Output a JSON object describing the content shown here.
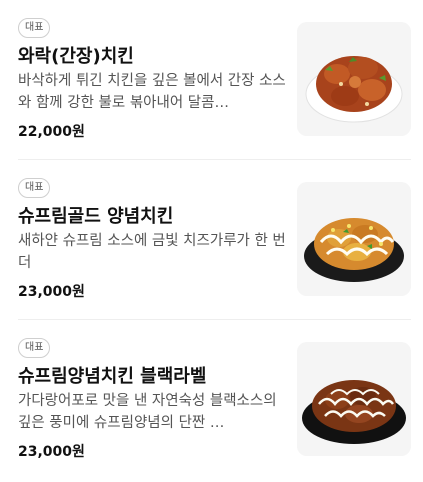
{
  "menu": {
    "items": [
      {
        "badge": "대표",
        "name": "와락(간장)치킨",
        "description": "바삭하게 튀긴 치킨을 깊은 볼에서 간장 소스와 함께 강한 불로 볶아내어 달콤…",
        "price": "22,000원",
        "image": "soy-sauce-chicken-photo"
      },
      {
        "badge": "대표",
        "name": "슈프림골드 양념치킨",
        "description": "새하얀 슈프림 소스에 금빛 치즈가루가 한 번 더",
        "price": "23,000원",
        "image": "supreme-gold-chicken-photo"
      },
      {
        "badge": "대표",
        "name": "슈프림양념치킨 블랙라벨",
        "description": "가다랑어포로 맛을 낸 자연숙성 블랙소스의 깊은 풍미에 슈프림양념의 단짠 …",
        "price": "23,000원",
        "image": "supreme-black-label-chicken-photo"
      }
    ]
  },
  "colors": {
    "background": "#ffffff",
    "divider": "#eeeeee",
    "thumb_bg": "#f5f5f5"
  }
}
